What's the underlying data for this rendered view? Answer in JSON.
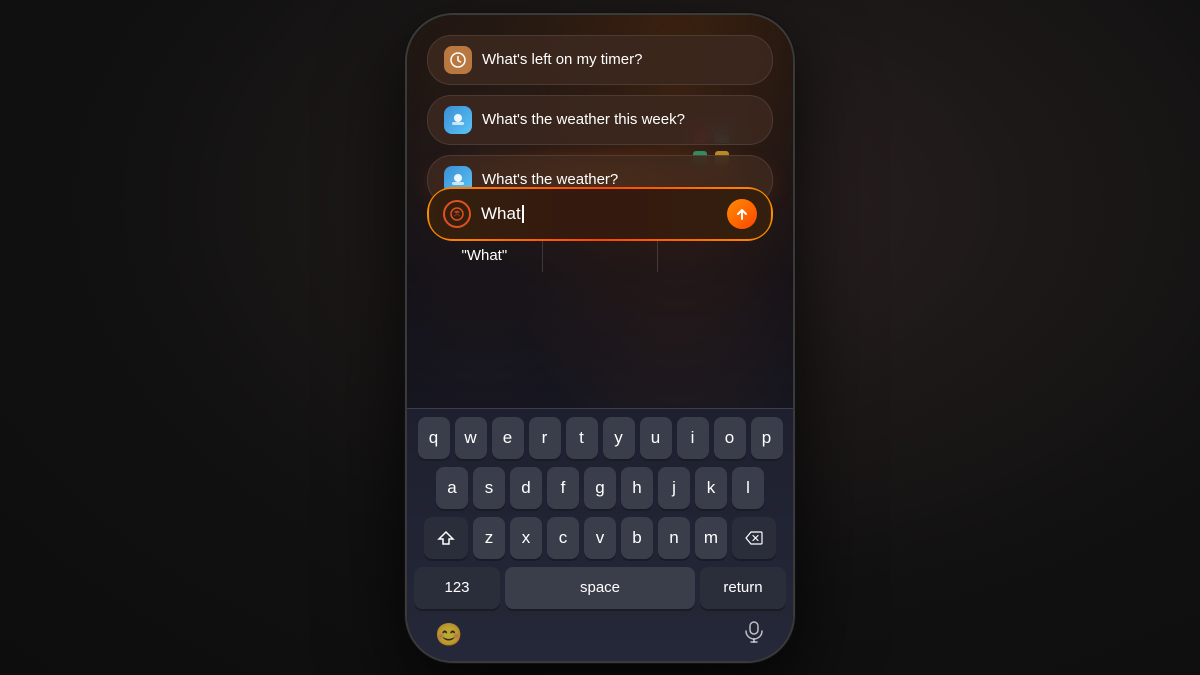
{
  "background": {
    "color": "#1a1a1a"
  },
  "suggestions": [
    {
      "icon_type": "clock",
      "icon_emoji": "🕐",
      "text": "What's left on my timer?"
    },
    {
      "icon_type": "weather",
      "icon_emoji": "🌤️",
      "text": "What's the weather this week?"
    },
    {
      "icon_type": "weather",
      "icon_emoji": "🌤️",
      "text": "What's the weather?"
    }
  ],
  "search_bar": {
    "input_value": "What",
    "send_button_label": "↑"
  },
  "autocomplete": {
    "items": [
      "\"What\"",
      "",
      ""
    ]
  },
  "keyboard": {
    "rows": [
      [
        "q",
        "w",
        "e",
        "r",
        "t",
        "y",
        "u",
        "i",
        "o",
        "p"
      ],
      [
        "a",
        "s",
        "d",
        "f",
        "g",
        "h",
        "j",
        "k",
        "l"
      ],
      [
        "⇧",
        "z",
        "x",
        "c",
        "v",
        "b",
        "n",
        "m",
        "⌫"
      ]
    ],
    "bottom_row": {
      "numbers_label": "123",
      "space_label": "space",
      "return_label": "return"
    }
  },
  "bottom_icons": {
    "emoji_icon": "😊",
    "mic_icon": "🎤"
  }
}
